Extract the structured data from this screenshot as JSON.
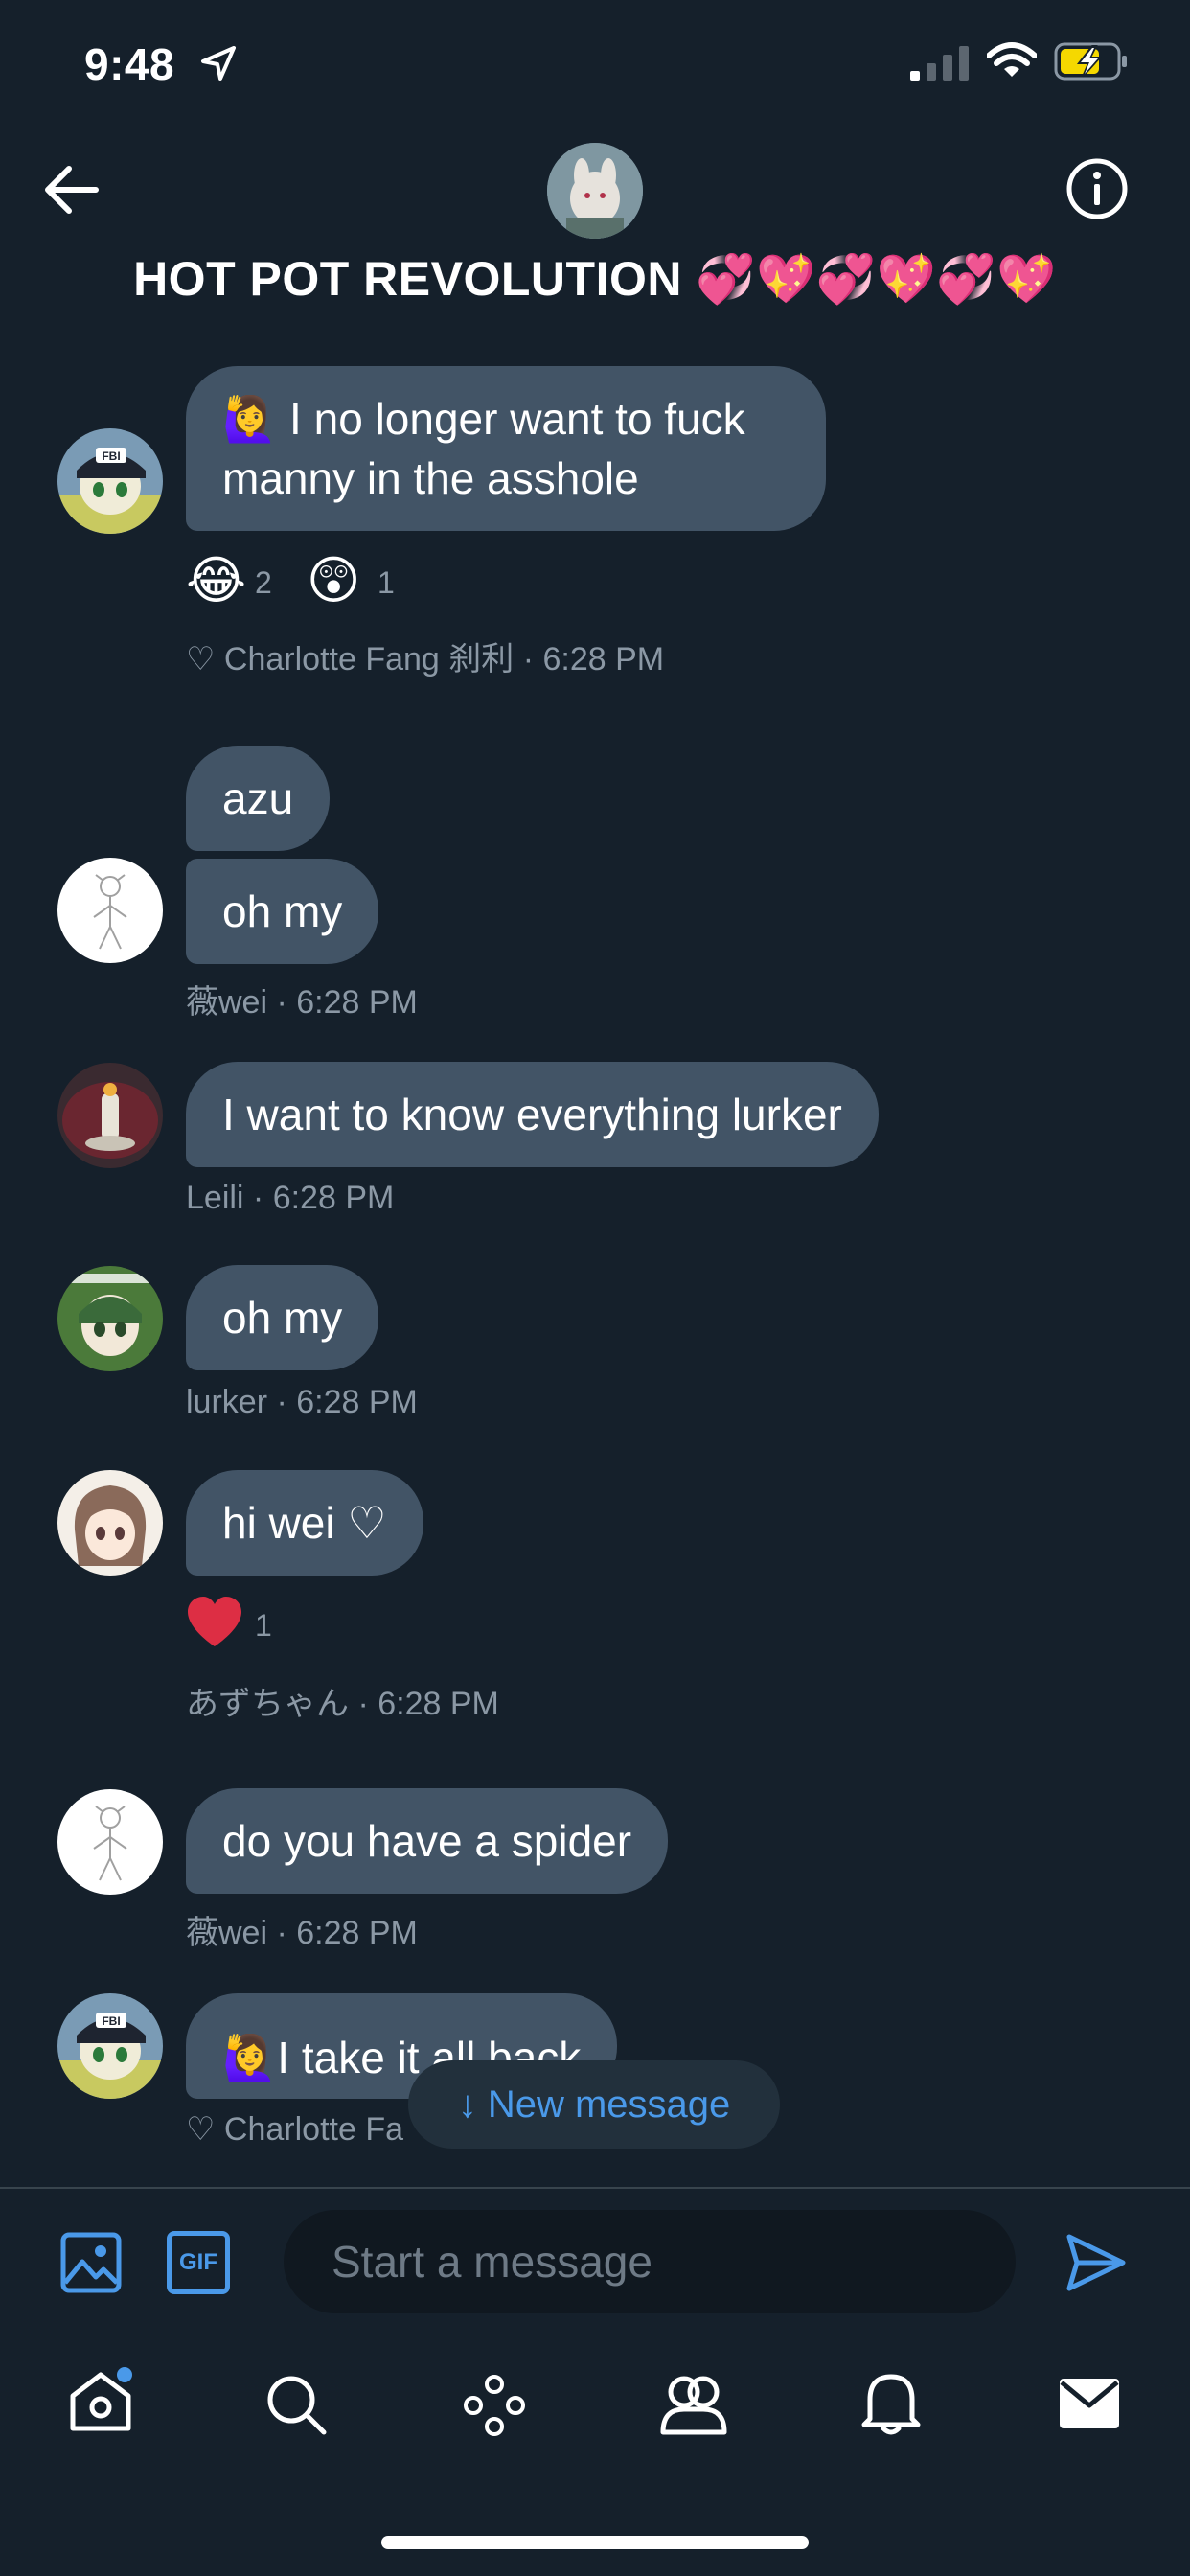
{
  "status_bar": {
    "time": "9:48"
  },
  "header": {
    "title": "HOT POT REVOLUTION 💞💖💞💖💞💖"
  },
  "messages": [
    {
      "text": "🙋‍♀️ I no longer want to fuck manny in the asshole",
      "reactions": [
        {
          "emoji": "😂",
          "count": "2"
        },
        {
          "emoji": "😲",
          "count": "1"
        }
      ],
      "meta": "♡ Charlotte Fang 刹利 · 6:28 PM"
    },
    {
      "texts": [
        "azu",
        "oh my"
      ],
      "meta": "薇wei · 6:28 PM"
    },
    {
      "text": "I want to know everything lurker",
      "meta": "Leili · 6:28 PM"
    },
    {
      "text": "oh my",
      "meta": "lurker · 6:28 PM"
    },
    {
      "text": "hi wei ♡",
      "reactions": [
        {
          "emoji": "❤️",
          "count": "1"
        }
      ],
      "meta": "あずちゃん · 6:28 PM"
    },
    {
      "text": "do you have a spider",
      "meta": "薇wei · 6:28 PM"
    },
    {
      "text": "🙋‍♀️I take it all back",
      "meta": "♡ Charlotte Fa"
    }
  ],
  "new_message_pill": {
    "label": "↓ New message"
  },
  "composer": {
    "placeholder": "Start a message",
    "gif_label": "GIF"
  },
  "colors": {
    "background": "#15202b",
    "bubble": "#425466",
    "accent": "#4a99e9",
    "meta_text": "#8b98a5",
    "battery_charging": "#f5d800"
  },
  "icons": {
    "back": "arrow-left-icon",
    "info": "info-icon",
    "location": "location-arrow-icon",
    "image": "image-icon",
    "gif": "gif-icon",
    "send": "send-icon",
    "home": "home-icon",
    "search": "search-icon",
    "spaces": "spaces-icon",
    "communities": "communities-icon",
    "notifications": "bell-icon",
    "messages": "mail-icon"
  }
}
